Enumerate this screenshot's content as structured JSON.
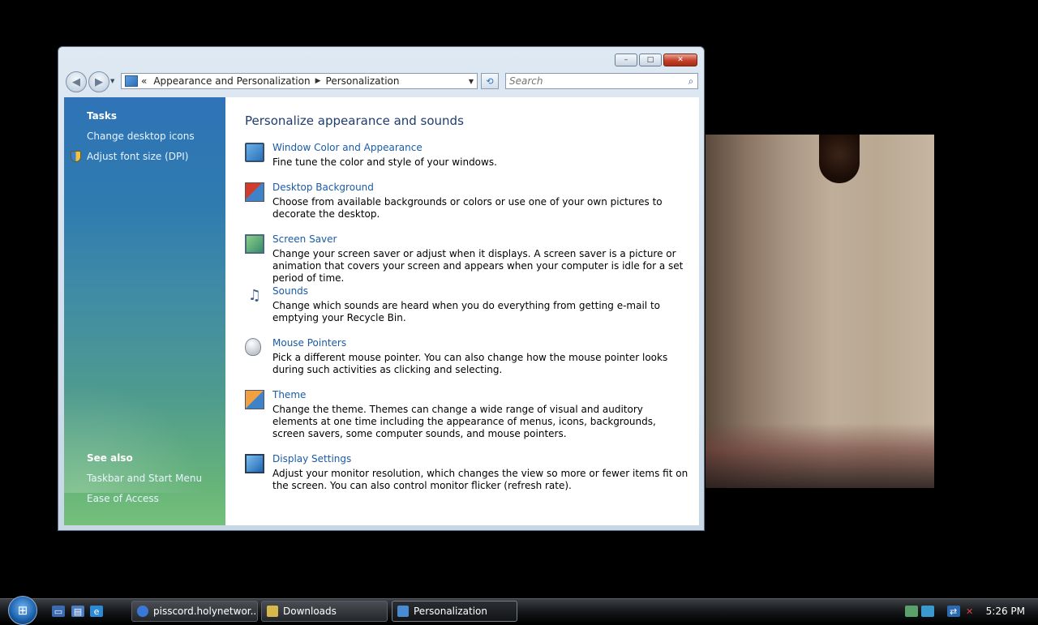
{
  "window": {
    "controls": {
      "minimize": "–",
      "maximize": "□",
      "close": "✕"
    },
    "nav": {
      "back": "◀",
      "forward": "▶",
      "recent": "▼"
    },
    "address": {
      "prefix": "«",
      "parent": "Appearance and Personalization",
      "separator": "▶",
      "current": "Personalization",
      "dropdown": "▼"
    },
    "refresh": "⟲",
    "search": {
      "placeholder": "Search",
      "icon": "⌕"
    }
  },
  "sidebar": {
    "tasks_heading": "Tasks",
    "tasks": [
      "Change desktop icons",
      "Adjust font size (DPI)"
    ],
    "see_also_heading": "See also",
    "see_also": [
      "Taskbar and Start Menu",
      "Ease of Access"
    ]
  },
  "main": {
    "heading": "Personalize appearance and sounds",
    "items": [
      {
        "title": "Window Color and Appearance",
        "desc": "Fine tune the color and style of your windows.",
        "icon": "window-color-icon"
      },
      {
        "title": "Desktop Background",
        "desc": "Choose from available backgrounds or colors or use one of your own pictures to decorate the desktop.",
        "icon": "desktop-background-icon"
      },
      {
        "title": "Screen Saver",
        "desc": "Change your screen saver or adjust when it displays. A screen saver is a picture or animation that covers your screen and appears when your computer is idle for a set period of time.",
        "icon": "screen-saver-icon"
      },
      {
        "title": "Sounds",
        "desc": "Change which sounds are heard when you do everything from getting e-mail to emptying your Recycle Bin.",
        "icon": "sounds-icon"
      },
      {
        "title": "Mouse Pointers",
        "desc": "Pick a different mouse pointer. You can also change how the mouse pointer looks during such activities as clicking and selecting.",
        "icon": "mouse-pointers-icon"
      },
      {
        "title": "Theme",
        "desc": "Change the theme. Themes can change a wide range of visual and auditory elements at one time including the appearance of menus, icons, backgrounds, screen savers, some computer sounds, and mouse pointers.",
        "icon": "theme-icon"
      },
      {
        "title": "Display Settings",
        "desc": "Adjust your monitor resolution, which changes the view so more or fewer items fit on the screen. You can also control monitor flicker (refresh rate).",
        "icon": "display-settings-icon"
      }
    ]
  },
  "taskbar": {
    "start": "⊞",
    "quick_launch": {
      "show_desktop": "▭",
      "switch_windows": "▤",
      "browser": "e"
    },
    "tasks": [
      {
        "label": "pisscord.holynetwor...",
        "icon_color": "#3a78d8"
      },
      {
        "label": "Downloads",
        "icon_color": "#d8b84a"
      },
      {
        "label": "Personalization",
        "icon_color": "#4a8ad0"
      }
    ],
    "tray_icons": {
      "network": "⇄",
      "volume": "✕"
    },
    "clock": "5:26 PM"
  }
}
